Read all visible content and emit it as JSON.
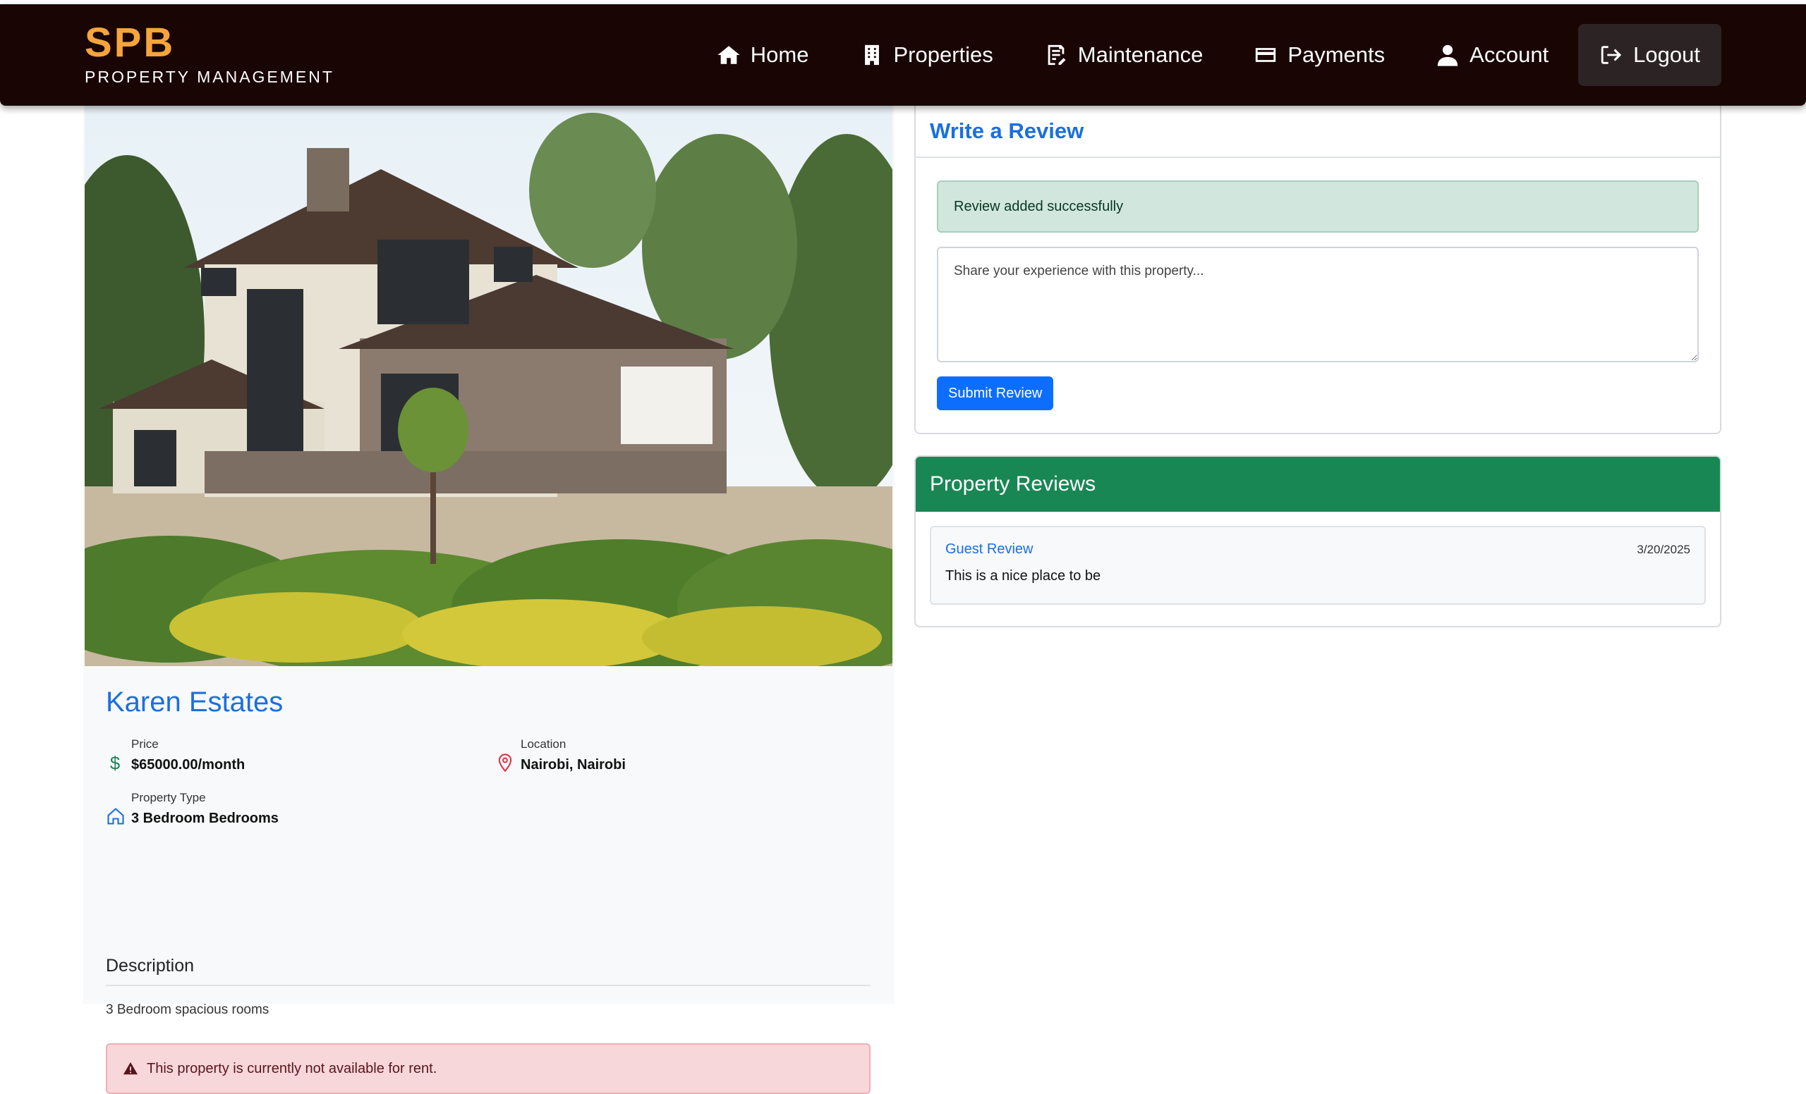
{
  "brand": {
    "name": "SPB",
    "subtitle": "PROPERTY MANAGEMENT"
  },
  "nav": {
    "items": [
      {
        "label": "Home",
        "icon": "home-icon"
      },
      {
        "label": "Properties",
        "icon": "building-icon"
      },
      {
        "label": "Maintenance",
        "icon": "maintenance-icon"
      },
      {
        "label": "Payments",
        "icon": "credit-card-icon"
      },
      {
        "label": "Account",
        "icon": "user-icon"
      },
      {
        "label": "Logout",
        "icon": "logout-icon"
      }
    ]
  },
  "property": {
    "title": "Karen Estates",
    "price_label": "Price",
    "price_value": "$65000.00/month",
    "location_label": "Location",
    "location_value": "Nairobi, Nairobi",
    "type_label": "Property Type",
    "type_value": "3 Bedroom Bedrooms",
    "description_heading": "Description",
    "description_text": "3 Bedroom spacious rooms",
    "availability_alert": "This property is currently not available for rent."
  },
  "review_form": {
    "title": "Write a Review",
    "success_message": "Review added successfully",
    "placeholder": "Share your experience with this property...",
    "submit_label": "Submit Review"
  },
  "reviews": {
    "title": "Property Reviews",
    "items": [
      {
        "author": "Guest Review",
        "date": "3/20/2025",
        "text": "This is a nice place to be"
      }
    ]
  },
  "colors": {
    "navbar_bg": "#1a0505",
    "brand_accent": "#f5a53b",
    "link_blue": "#1a6fe0",
    "primary_button": "#0d6efd",
    "reviews_header_green": "#198754",
    "success_bg": "#d1e7dd",
    "danger_bg": "#f8d7da"
  }
}
